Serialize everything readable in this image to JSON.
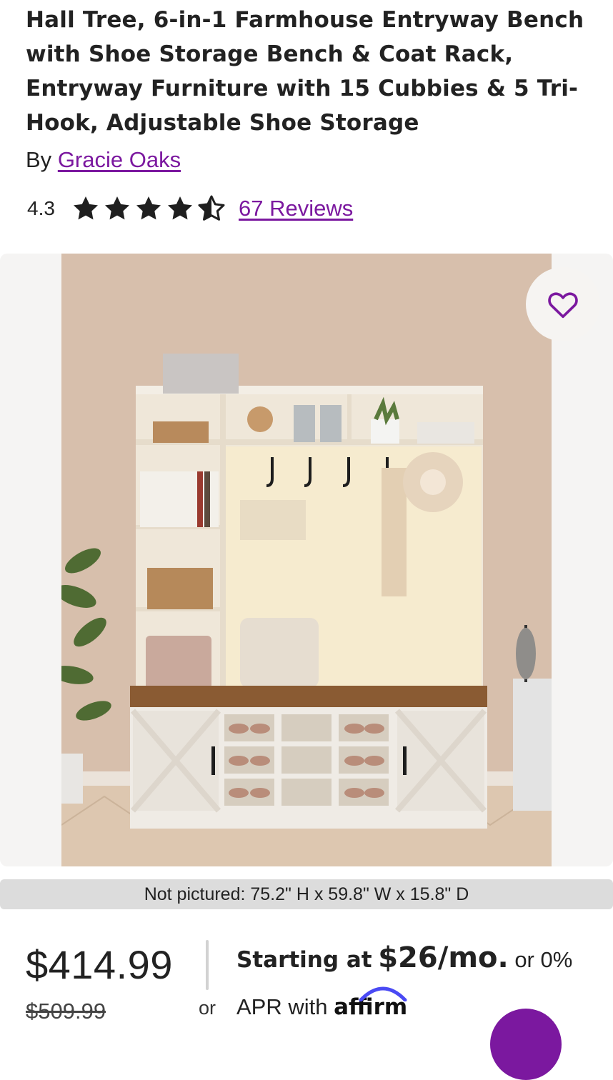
{
  "product": {
    "title": "Hall Tree, 6-in-1 Farmhouse Entryway Bench with Shoe Storage Bench & Coat Rack, Entryway Furniture with 15 Cubbies & 5 Tri-Hook, Adjustable Shoe Storage",
    "by_prefix": "By",
    "brand": "Gracie Oaks",
    "rating": "4.3",
    "rating_value": 4.3,
    "rating_max": 5,
    "reviews_label": "67 Reviews"
  },
  "gallery": {
    "image_count": 5,
    "active_index": 0,
    "favorite_icon": "heart-outline-icon"
  },
  "dimensions": {
    "label": "Not pictured: 75.2\" H x 59.8\" W x 15.8\" D"
  },
  "pricing": {
    "price": "$414.99",
    "was_price": "$509.99",
    "or": "or",
    "financing": {
      "starting_at": "Starting at",
      "monthly": "$26/mo.",
      "or_zero": "or 0%",
      "apr_with": "APR with",
      "provider": "affirm"
    }
  },
  "colors": {
    "accent": "#7b189f",
    "text": "#222222",
    "gallery_bg": "#f5f4f3",
    "dims_bar": "#dcdcdc"
  }
}
